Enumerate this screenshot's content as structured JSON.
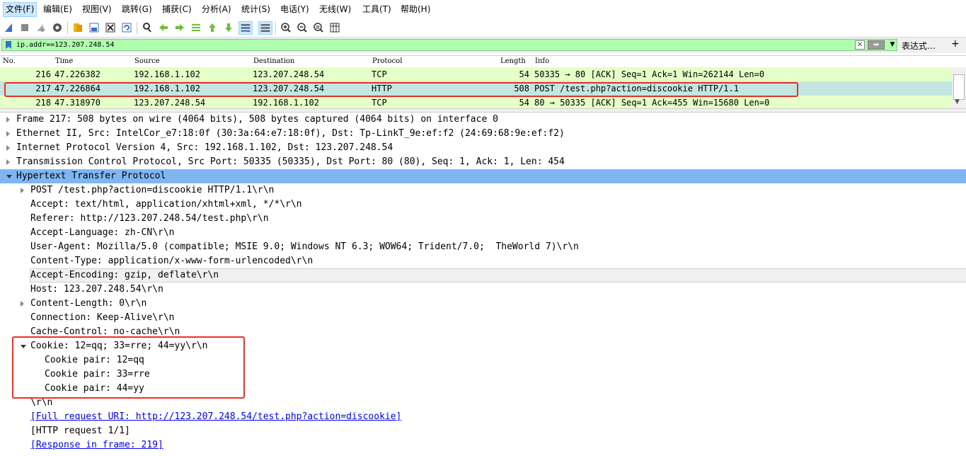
{
  "menu": [
    "文件(F)",
    "编辑(E)",
    "视图(V)",
    "跳转(G)",
    "捕获(C)",
    "分析(A)",
    "统计(S)",
    "电话(Y)",
    "无线(W)",
    "工具(T)",
    "帮助(H)"
  ],
  "toolbar_icons": [
    "shark-fin-start-icon",
    "stop-icon",
    "restart-icon",
    "options-gear-icon",
    "open-file-icon",
    "save-file-icon",
    "close-file-icon",
    "reload-icon",
    "find-icon",
    "go-back-icon",
    "go-forward-icon",
    "go-to-packet-icon",
    "first-packet-icon",
    "last-packet-icon",
    "autoscroll-icon",
    "colorize-icon",
    "zoom-in-icon",
    "zoom-out-icon",
    "zoom-normal-icon",
    "resize-columns-icon"
  ],
  "filter": {
    "value": "ip.addr==123.207.248.54",
    "expression_label": "表达式…",
    "plus_label": "+",
    "clear_glyph": "✕",
    "apply_glyph": "➡",
    "dropdown_glyph": "▼"
  },
  "packet_list": {
    "columns": [
      "No.",
      "Time",
      "Source",
      "Destination",
      "Protocol",
      "Length",
      "Info"
    ],
    "rows": [
      {
        "no": "216",
        "time": "47.226382",
        "source": "192.168.1.102",
        "destination": "123.207.248.54",
        "protocol": "TCP",
        "length": "54",
        "info": "50335 → 80 [ACK] Seq=1 Ack=1 Win=262144 Len=0",
        "selected": false
      },
      {
        "no": "217",
        "time": "47.226864",
        "source": "192.168.1.102",
        "destination": "123.207.248.54",
        "protocol": "HTTP",
        "length": "508",
        "info": "POST /test.php?action=discookie HTTP/1.1",
        "selected": true
      },
      {
        "no": "218",
        "time": "47.318970",
        "source": "123.207.248.54",
        "destination": "192.168.1.102",
        "protocol": "TCP",
        "length": "54",
        "info": "80 → 50335 [ACK] Seq=1 Ack=455 Win=15680 Len=0",
        "selected": false
      }
    ]
  },
  "details": [
    {
      "text": "Frame 217: 508 bytes on wire (4064 bits), 508 bytes captured (4064 bits) on interface 0",
      "indent": 0,
      "expander": "collapsed"
    },
    {
      "text": "Ethernet II, Src: IntelCor_e7:18:0f (30:3a:64:e7:18:0f), Dst: Tp-LinkT_9e:ef:f2 (24:69:68:9e:ef:f2)",
      "indent": 0,
      "expander": "collapsed"
    },
    {
      "text": "Internet Protocol Version 4, Src: 192.168.1.102, Dst: 123.207.248.54",
      "indent": 0,
      "expander": "collapsed"
    },
    {
      "text": "Transmission Control Protocol, Src Port: 50335 (50335), Dst Port: 80 (80), Seq: 1, Ack: 1, Len: 454",
      "indent": 0,
      "expander": "collapsed"
    },
    {
      "text": "Hypertext Transfer Protocol",
      "indent": 0,
      "expander": "expanded",
      "highlight": true
    },
    {
      "text": "POST /test.php?action=discookie HTTP/1.1\\r\\n",
      "indent": 1,
      "expander": "collapsed"
    },
    {
      "text": "Accept: text/html, application/xhtml+xml, */*\\r\\n",
      "indent": 1,
      "expander": "none"
    },
    {
      "text": "Referer: http://123.207.248.54/test.php\\r\\n",
      "indent": 1,
      "expander": "none"
    },
    {
      "text": "Accept-Language: zh-CN\\r\\n",
      "indent": 1,
      "expander": "none"
    },
    {
      "text": "User-Agent: Mozilla/5.0 (compatible; MSIE 9.0; Windows NT 6.3; WOW64; Trident/7.0;  TheWorld 7)\\r\\n",
      "indent": 1,
      "expander": "none"
    },
    {
      "text": "Content-Type: application/x-www-form-urlencoded\\r\\n",
      "indent": 1,
      "expander": "none"
    },
    {
      "text": "Accept-Encoding: gzip, deflate\\r\\n",
      "indent": 1,
      "expander": "none",
      "boxed": true
    },
    {
      "text": "Host: 123.207.248.54\\r\\n",
      "indent": 1,
      "expander": "none"
    },
    {
      "text": "Content-Length: 0\\r\\n",
      "indent": 1,
      "expander": "collapsed"
    },
    {
      "text": "Connection: Keep-Alive\\r\\n",
      "indent": 1,
      "expander": "none"
    },
    {
      "text": "Cache-Control: no-cache\\r\\n",
      "indent": 1,
      "expander": "none"
    },
    {
      "text": "Cookie: 12=qq; 33=rre; 44=yy\\r\\n",
      "indent": 1,
      "expander": "expanded"
    },
    {
      "text": "Cookie pair: 12=qq",
      "indent": 2,
      "expander": "none"
    },
    {
      "text": "Cookie pair: 33=rre",
      "indent": 2,
      "expander": "none"
    },
    {
      "text": "Cookie pair: 44=yy",
      "indent": 2,
      "expander": "none"
    },
    {
      "text": "\\r\\n",
      "indent": 1,
      "expander": "none"
    },
    {
      "text": "[Full request URI: http://123.207.248.54/test.php?action=discookie]",
      "indent": 1,
      "expander": "none",
      "link": true
    },
    {
      "text": "[HTTP request 1/1]",
      "indent": 1,
      "expander": "none"
    },
    {
      "text": "[Response in frame: 219]",
      "indent": 1,
      "expander": "none",
      "link": true
    }
  ],
  "colors": {
    "filter_bg": "#afffaf",
    "row_bg": "#e4ffc7",
    "selected_row_bg": "#c3e6e0",
    "detail_highlight": "#7fb6f2",
    "annotation_red": "#e53228"
  }
}
